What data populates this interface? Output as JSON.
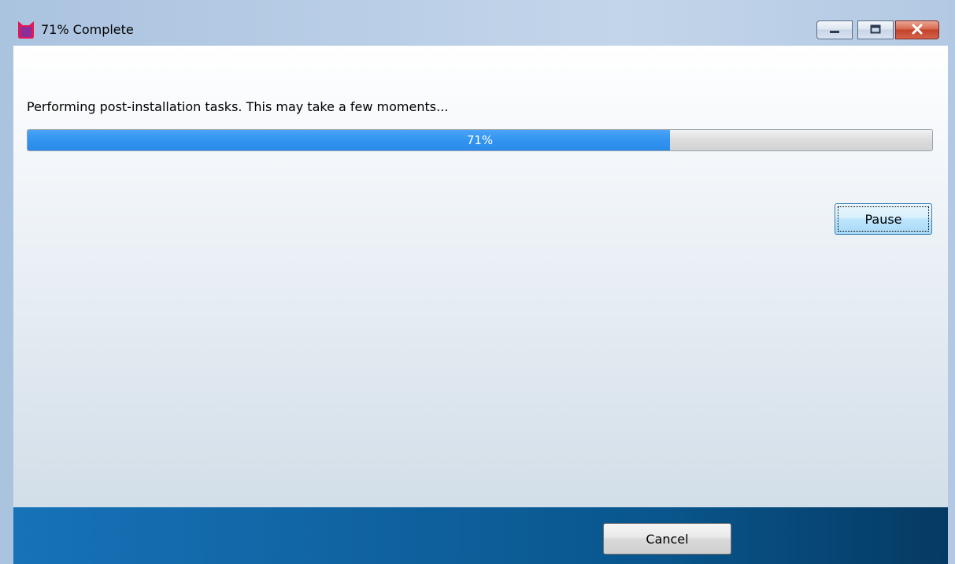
{
  "window": {
    "title": "71% Complete",
    "icon": "cat-head-icon",
    "controls": {
      "minimize_icon": "minimize-icon",
      "maximize_icon": "maximize-icon",
      "close_icon": "close-icon"
    }
  },
  "main": {
    "status_text": "Performing post-installation tasks.  This may take a few moments...",
    "progress": {
      "value_percent": 71,
      "label": "71%"
    },
    "pause_label": "Pause"
  },
  "footer": {
    "cancel_label": "Cancel"
  },
  "colors": {
    "progress_fill": "#3294f0",
    "footer_start": "#1772b8",
    "footer_end": "#053a63",
    "close_button": "#c3422a",
    "app_icon_red": "#e0195a",
    "app_icon_purple": "#8e2d98"
  }
}
